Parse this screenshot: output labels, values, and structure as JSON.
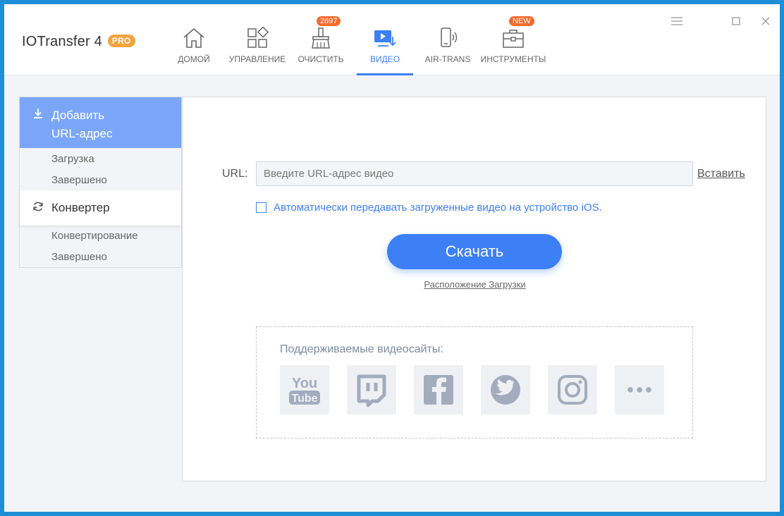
{
  "app": {
    "name": "IOTransfer 4",
    "edition_badge": "PRO"
  },
  "nav": {
    "items": [
      {
        "label": "ДОМОЙ",
        "icon": "home-icon"
      },
      {
        "label": "УПРАВЛЕНИЕ",
        "icon": "manage-icon"
      },
      {
        "label": "ОЧИСТИТЬ",
        "icon": "clean-broom-icon",
        "badge": "2697"
      },
      {
        "label": "ВИДЕО",
        "icon": "video-download-icon",
        "active": true
      },
      {
        "label": "AIR-TRANS",
        "icon": "phone-wireless-icon"
      },
      {
        "label": "ИНСТРУМЕНТЫ",
        "icon": "toolbox-icon",
        "badge": "NEW"
      }
    ]
  },
  "window_controls": [
    "menu-icon",
    "maximize-icon",
    "close-icon"
  ],
  "sidebar": {
    "add_url": {
      "label_line1": "Добавить",
      "label_line2": "URL-адрес",
      "icon": "download-arrow-icon"
    },
    "add_url_subitems": [
      "Загрузка",
      "Завершено"
    ],
    "converter": {
      "label": "Конвертер",
      "icon": "refresh-icon"
    },
    "converter_subitems": [
      "Конвертирование",
      "Завершено"
    ]
  },
  "main": {
    "url_label": "URL:",
    "url_placeholder": "Введите URL-адрес видео",
    "url_value": "",
    "paste_label": "Вставить",
    "auto_transfer_label": "Автоматически передавать загруженные видео на устройство iOS.",
    "auto_transfer_checked": false,
    "download_label": "Скачать",
    "location_label": "Расположение Загрузки",
    "supported_title": "Поддерживаемые видеосайты:",
    "supported_sites": [
      "youtube-icon",
      "twitch-icon",
      "facebook-icon",
      "twitter-icon",
      "instagram-icon",
      "more-icon"
    ]
  },
  "colors": {
    "accent": "#3d7ff5",
    "sidebar_active": "#7ba6f7",
    "badge": "#f26b2e",
    "pro_badge": "#f2a33c",
    "site_icon": "#a3acbd"
  }
}
